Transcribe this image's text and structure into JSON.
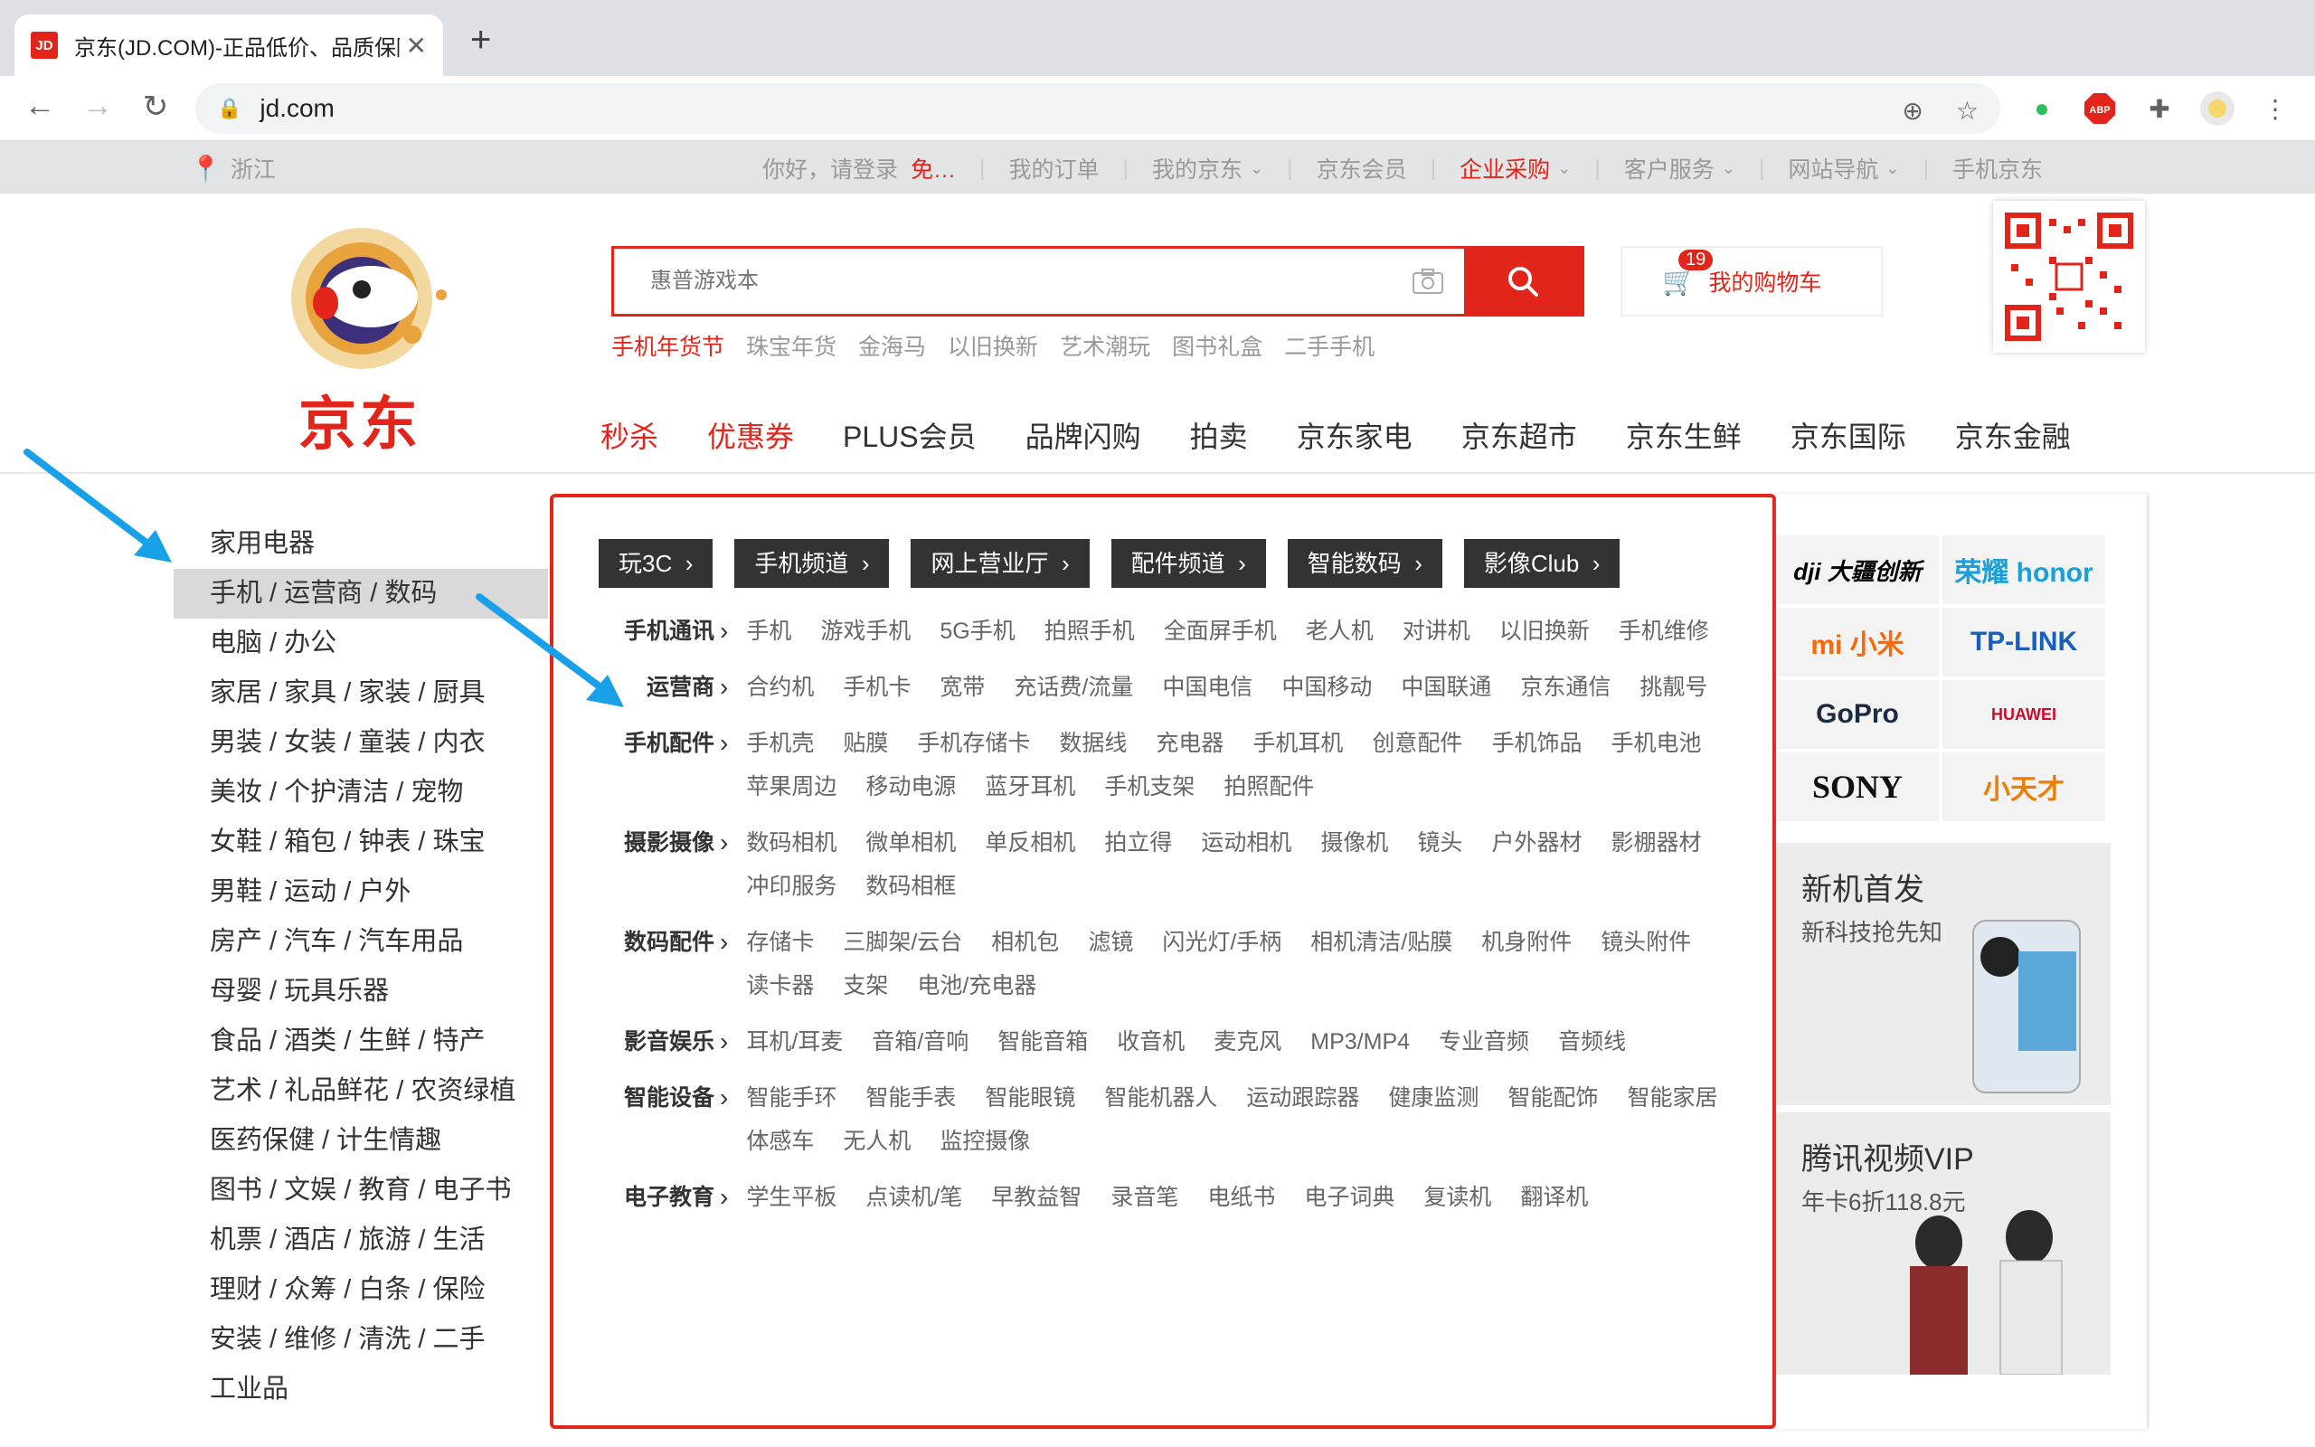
{
  "browser": {
    "tab_title": "京东(JD.COM)-正品低价、品质保障",
    "favicon_text": "JD",
    "url": "jd.com"
  },
  "topbar": {
    "location": "浙江",
    "greeting": "你好，请登录",
    "register": "免…",
    "links": [
      "我的订单",
      "我的京东",
      "京东会员",
      "企业采购",
      "客户服务",
      "网站导航",
      "手机京东"
    ]
  },
  "header": {
    "logo_text": "京东",
    "search_placeholder": "惠普游戏本",
    "cart_label": "我的购物车",
    "cart_count": "19",
    "hotwords": [
      "手机年货节",
      "珠宝年货",
      "金海马",
      "以旧换新",
      "艺术潮玩",
      "图书礼盒",
      "二手手机"
    ],
    "main_nav": [
      "秒杀",
      "优惠券",
      "PLUS会员",
      "品牌闪购",
      "拍卖",
      "京东家电",
      "京东超市",
      "京东生鲜",
      "京东国际",
      "京东金融"
    ]
  },
  "categories": [
    "家用电器",
    "手机 / 运营商 / 数码",
    "电脑 / 办公",
    "家居 / 家具 / 家装 / 厨具",
    "男装 / 女装 / 童装 / 内衣",
    "美妆 / 个护清洁 / 宠物",
    "女鞋 / 箱包 / 钟表 / 珠宝",
    "男鞋 / 运动 / 户外",
    "房产 / 汽车 / 汽车用品",
    "母婴 / 玩具乐器",
    "食品 / 酒类 / 生鲜 / 特产",
    "艺术 / 礼品鲜花 / 农资绿植",
    "医药保健 / 计生情趣",
    "图书 / 文娱 / 教育 / 电子书",
    "机票 / 酒店 / 旅游 / 生活",
    "理财 / 众筹 / 白条 / 保险",
    "安装 / 维修 / 清洗 / 二手",
    "工业品"
  ],
  "popup": {
    "channels": [
      "玩3C",
      "手机频道",
      "网上营业厅",
      "配件频道",
      "智能数码",
      "影像Club"
    ],
    "groups": [
      {
        "title": "手机通讯",
        "items": [
          "手机",
          "游戏手机",
          "5G手机",
          "拍照手机",
          "全面屏手机",
          "老人机",
          "对讲机",
          "以旧换新",
          "手机维修"
        ]
      },
      {
        "title": "运营商",
        "items": [
          "合约机",
          "手机卡",
          "宽带",
          "充话费/流量",
          "中国电信",
          "中国移动",
          "中国联通",
          "京东通信",
          "挑靓号"
        ]
      },
      {
        "title": "手机配件",
        "items": [
          "手机壳",
          "贴膜",
          "手机存储卡",
          "数据线",
          "充电器",
          "手机耳机",
          "创意配件",
          "手机饰品",
          "手机电池",
          "苹果周边",
          "移动电源",
          "蓝牙耳机",
          "手机支架",
          "拍照配件"
        ]
      },
      {
        "title": "摄影摄像",
        "items": [
          "数码相机",
          "微单相机",
          "单反相机",
          "拍立得",
          "运动相机",
          "摄像机",
          "镜头",
          "户外器材",
          "影棚器材",
          "冲印服务",
          "数码相框"
        ]
      },
      {
        "title": "数码配件",
        "items": [
          "存储卡",
          "三脚架/云台",
          "相机包",
          "滤镜",
          "闪光灯/手柄",
          "相机清洁/贴膜",
          "机身附件",
          "镜头附件",
          "读卡器",
          "支架",
          "电池/充电器"
        ]
      },
      {
        "title": "影音娱乐",
        "items": [
          "耳机/耳麦",
          "音箱/音响",
          "智能音箱",
          "收音机",
          "麦克风",
          "MP3/MP4",
          "专业音频",
          "音频线"
        ]
      },
      {
        "title": "智能设备",
        "items": [
          "智能手环",
          "智能手表",
          "智能眼镜",
          "智能机器人",
          "运动跟踪器",
          "健康监测",
          "智能配饰",
          "智能家居",
          "体感车",
          "无人机",
          "监控摄像"
        ]
      },
      {
        "title": "电子教育",
        "items": [
          "学生平板",
          "点读机/笔",
          "早教益智",
          "录音笔",
          "电纸书",
          "电子词典",
          "复读机",
          "翻译机"
        ]
      }
    ]
  },
  "brands": [
    "dji 大疆创新",
    "荣耀 honor",
    "mi 小米",
    "TP-LINK",
    "GoPro",
    "HUAWEI",
    "SONY",
    "小天才"
  ],
  "promos": [
    {
      "title": "新机首发",
      "subtitle": "新科技抢先知"
    },
    {
      "title": "腾讯视频VIP",
      "subtitle": "年卡6折118.8元"
    }
  ],
  "colors": {
    "brand_red": "#e1251b",
    "annotation_arrow": "#1aa0e8"
  }
}
